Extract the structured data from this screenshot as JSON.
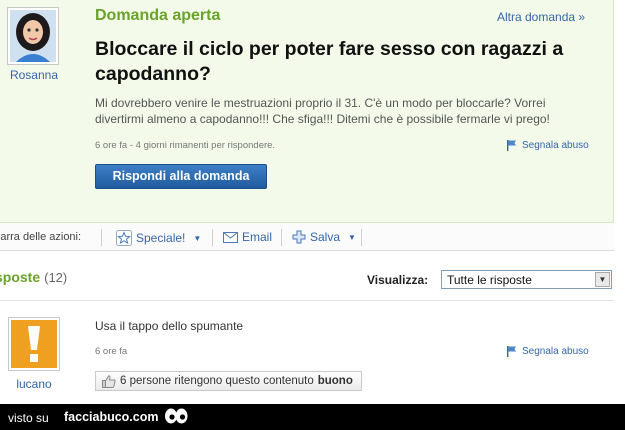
{
  "question": {
    "asker_name": "Rosanna",
    "status": "Domanda aperta",
    "other_link": "Altra domanda »",
    "title": "Bloccare il ciclo per poter fare sesso con ragazzi a capodanno?",
    "body": "Mi dovrebbero venire le mestruazioni proprio il 31. C'è un modo per bloccarle? Vorrei divertirmi almeno a capodanno!!! Che sfiga!!! Ditemi che è possibile fermarle vi prego!",
    "meta": "6 ore fa - 4 giorni rimanenti per rispondere.",
    "report_label": "Segnala abuso",
    "answer_button": "Rispondi alla domanda"
  },
  "action_bar": {
    "label": "Barra delle azioni:",
    "special": "Speciale!",
    "email": "Email",
    "save": "Salva"
  },
  "answers": {
    "title": "Risposte",
    "count": "(12)",
    "view_label": "Visualizza:",
    "view_selected": "Tutte le risposte",
    "items": [
      {
        "user": "lucano",
        "text": "Usa il tappo dello spumante",
        "time": "6 ore fa",
        "report_label": "Segnala abuso",
        "useful_prefix": "6 persone ritengono questo contenuto",
        "useful_rating": "buono"
      }
    ]
  },
  "footer": {
    "seen_on": "visto su",
    "brand": "facciabuco.com"
  },
  "colors": {
    "status_green": "#6aa32a",
    "link_blue": "#3366aa",
    "button_blue": "#2a6cb4",
    "answer_avatar_orange": "#f0a020"
  }
}
